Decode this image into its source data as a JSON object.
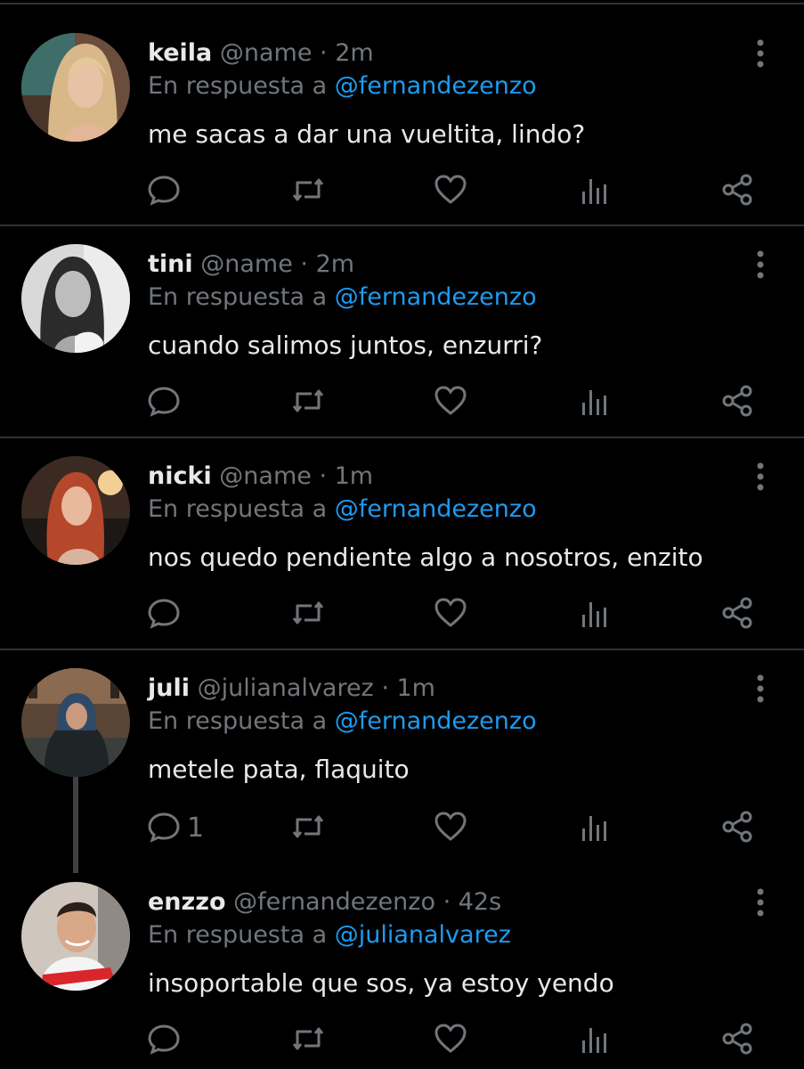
{
  "reply_prefix": "En respuesta a",
  "colors": {
    "background": "#000000",
    "text": "#e7e9ea",
    "muted": "#71767b",
    "accent": "#1d9bf0",
    "divider": "#2f3336"
  },
  "action_icons": [
    "reply-icon",
    "retweet-icon",
    "like-icon",
    "views-icon",
    "share-icon"
  ],
  "tweets": [
    {
      "display_name": "keila",
      "handle": "@name",
      "time": "· 2m",
      "reply_to": "@fernandezenzo",
      "text": "me sacas a dar una vueltita, lindo?",
      "reply_count": ""
    },
    {
      "display_name": "tini",
      "handle": "@name",
      "time": "· 2m",
      "reply_to": "@fernandezenzo",
      "text": "cuando salimos juntos, enzurri?",
      "reply_count": ""
    },
    {
      "display_name": "nicki",
      "handle": "@name",
      "time": "· 1m",
      "reply_to": "@fernandezenzo",
      "text": "nos quedo pendiente algo a nosotros, enzito",
      "reply_count": ""
    },
    {
      "display_name": "juli",
      "handle": "@julianalvarez",
      "time": "· 1m",
      "reply_to": "@fernandezenzo",
      "text": "metele pata, flaquito",
      "reply_count": "1"
    },
    {
      "display_name": "enzzo",
      "handle": "@fernandezenzo",
      "time": "· 42s",
      "reply_to": "@julianalvarez",
      "text": "insoportable que sos, ya estoy yendo",
      "reply_count": ""
    }
  ]
}
